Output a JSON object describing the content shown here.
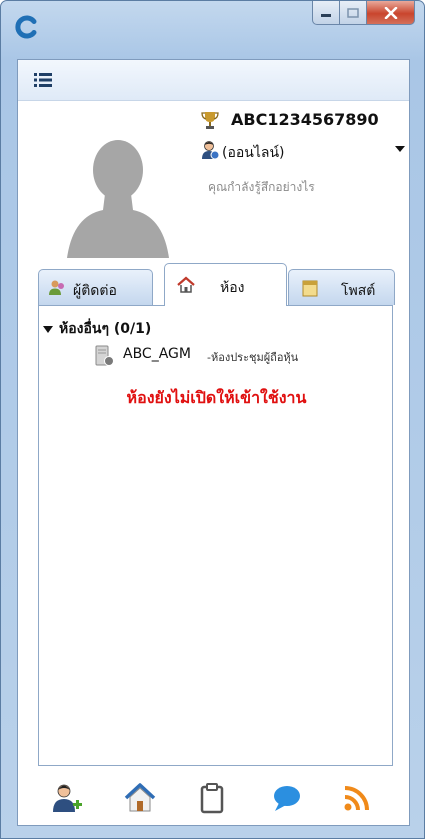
{
  "window": {
    "app_icon": "app-c-logo-icon",
    "controls": [
      "minimize-icon",
      "maximize-icon",
      "close-icon"
    ]
  },
  "menu": {
    "icon": "menu-list-icon"
  },
  "profile": {
    "avatar": "avatar-placeholder",
    "username": "ABC1234567890",
    "status": "(ออนไลน์)",
    "mood_placeholder": "คุณกำลังรู้สึกอย่างไร"
  },
  "tabs": [
    {
      "label": "ผู้ติดต่อ",
      "icon": "contacts-icon"
    },
    {
      "label": "ห้อง",
      "icon": "home-icon"
    },
    {
      "label": "โพสต์",
      "icon": "notes-icon"
    }
  ],
  "active_tab": 1,
  "rooms": {
    "group_label": "ห้องอื่นๆ (0/1)",
    "items": [
      {
        "name": "ABC_AGM",
        "description": "-ห้องประชุมผู้ถือหุ้น"
      }
    ],
    "notice": "ห้องยังไม่เปิดให้เข้าใช้งาน"
  },
  "bottom_icons": [
    "add-contact-icon",
    "home-icon",
    "clipboard-icon",
    "chat-bubble-icon",
    "rss-icon"
  ],
  "colors": {
    "notice": "#e01010",
    "frame": "#a9c6e6",
    "close": "#c9452d"
  }
}
